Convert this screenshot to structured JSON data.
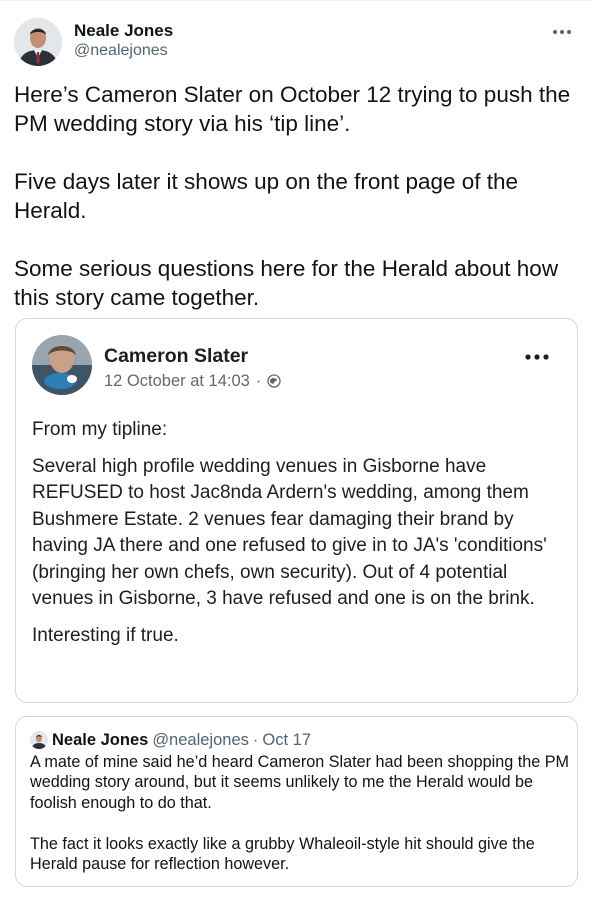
{
  "tweet": {
    "author_name": "Neale Jones",
    "author_handle": "@nealejones",
    "more_icon": "ellipsis-icon",
    "text": "Here’s Cameron Slater on October 12 trying to push the PM wedding story via his ‘tip line’.\n\nFive days later it shows up on the front page of the Herald.\n\nSome serious questions here for the Herald about how this story came together."
  },
  "facebook_post": {
    "author_name": "Cameron Slater",
    "timestamp": "12 October at 14:03",
    "separator": "·",
    "audience_icon": "globe-icon",
    "more_icon": "ellipsis-icon",
    "intro": "From my tipline:",
    "body": "Several high profile wedding venues in Gisborne have REFUSED to host Jac8nda Ardern's wedding, among them Bushmere Estate. 2 venues fear damaging their brand by having JA there and one refused to give in to JA's 'conditions' (bringing her own chefs, own security). Out of 4 potential venues in Gisborne, 3 have refused and one is on the brink.",
    "closing": "Interesting if true."
  },
  "quoted_tweet": {
    "author_name": "Neale Jones",
    "author_handle": "@nealejones",
    "separator": "·",
    "date": "Oct 17",
    "text": "A mate of mine said he’d heard Cameron Slater had been shopping the PM wedding story around, but it seems unlikely to me the Herald would be foolish enough to do that.\n\nThe fact it looks exactly like a grubby Whaleoil-style hit should give the Herald pause for reflection however."
  },
  "colors": {
    "text_primary": "#0f1419",
    "text_secondary": "#536471",
    "border": "#cfd9de",
    "fb_text": "#1c1e21",
    "fb_meta": "#65676b"
  }
}
